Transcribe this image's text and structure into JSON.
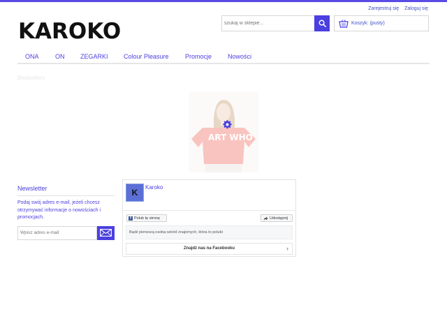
{
  "header": {
    "register_label": "Zarejestruj się",
    "login_label": "Zaloguj się",
    "logo_text": "KAROKO",
    "search_placeholder": "szukaj w sklepie...",
    "cart_label": "Koszyk:",
    "cart_status": "(pusty)"
  },
  "nav": {
    "items": [
      {
        "label": "ONA"
      },
      {
        "label": "ON"
      },
      {
        "label": "ZEGARKI"
      },
      {
        "label": "Colour Pleasure"
      },
      {
        "label": "Promocje"
      },
      {
        "label": "Nowości"
      }
    ]
  },
  "main": {
    "bestsellers_title": "Bestsellery",
    "product_image_text": "ART WHO",
    "loading_icon": "gear-icon"
  },
  "newsletter": {
    "title": "Newsletter",
    "description": "Podaj swój adres e-mail, jeżeli chcesz otrzymywać informacje o nowościach i promocjach.",
    "email_placeholder": "Wpisz adres e-mail"
  },
  "facebook": {
    "page_initial": "K",
    "page_name": "Karoko",
    "like_label": "Polub tę stronę",
    "share_label": "Udostępnij",
    "friends_text": "Bądź pierwszą osobą wśród znajomych, która to polubi",
    "find_label": "Znajdź nas na Facebooku"
  },
  "colors": {
    "accent": "#4a3fe0",
    "topbar": "#5b4be6",
    "facebook_blue": "#3b5998"
  }
}
